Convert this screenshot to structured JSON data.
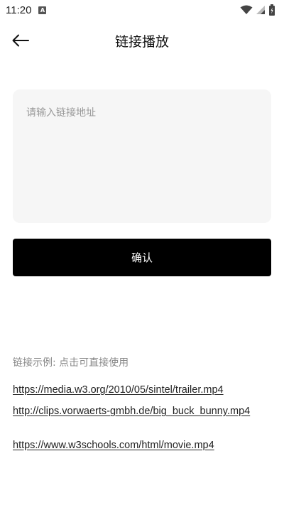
{
  "status_bar": {
    "time": "11:20",
    "notification_icon_letter": "A",
    "icons": [
      "wifi-icon",
      "signal-icon",
      "battery-icon"
    ]
  },
  "header": {
    "title": "链接播放",
    "back_icon": "arrow-left-icon"
  },
  "url_input": {
    "placeholder": "请输入链接地址",
    "value": ""
  },
  "confirm_button": {
    "label": "确认"
  },
  "examples": {
    "heading": "链接示例: 点击可直接使用",
    "links": [
      "https://media.w3.org/2010/05/sintel/trailer.mp4",
      "http://clips.vorwaerts-gmbh.de/big_buck_bunny.mp4",
      "https://www.w3schools.com/html/movie.mp4"
    ]
  },
  "colors": {
    "background": "#ffffff",
    "input_background": "#f6f6f6",
    "button_background": "#000000",
    "button_text": "#ffffff",
    "muted_text": "#888888"
  }
}
